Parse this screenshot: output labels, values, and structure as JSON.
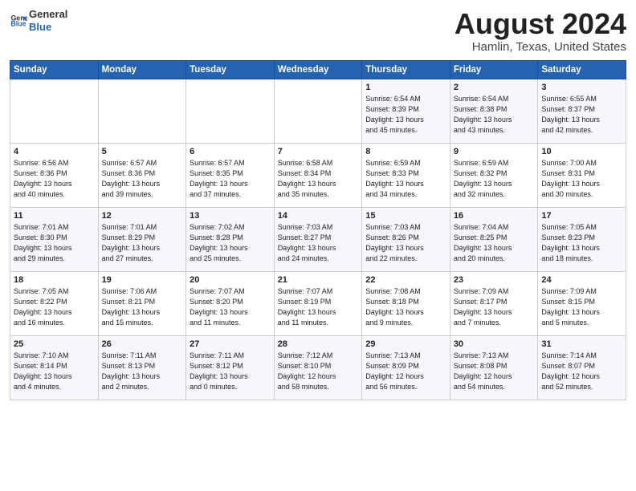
{
  "logo": {
    "general": "General",
    "blue": "Blue"
  },
  "title": "August 2024",
  "location": "Hamlin, Texas, United States",
  "days_header": [
    "Sunday",
    "Monday",
    "Tuesday",
    "Wednesday",
    "Thursday",
    "Friday",
    "Saturday"
  ],
  "weeks": [
    [
      {
        "day": "",
        "info": ""
      },
      {
        "day": "",
        "info": ""
      },
      {
        "day": "",
        "info": ""
      },
      {
        "day": "",
        "info": ""
      },
      {
        "day": "1",
        "info": "Sunrise: 6:54 AM\nSunset: 8:39 PM\nDaylight: 13 hours\nand 45 minutes."
      },
      {
        "day": "2",
        "info": "Sunrise: 6:54 AM\nSunset: 8:38 PM\nDaylight: 13 hours\nand 43 minutes."
      },
      {
        "day": "3",
        "info": "Sunrise: 6:55 AM\nSunset: 8:37 PM\nDaylight: 13 hours\nand 42 minutes."
      }
    ],
    [
      {
        "day": "4",
        "info": "Sunrise: 6:56 AM\nSunset: 8:36 PM\nDaylight: 13 hours\nand 40 minutes."
      },
      {
        "day": "5",
        "info": "Sunrise: 6:57 AM\nSunset: 8:36 PM\nDaylight: 13 hours\nand 39 minutes."
      },
      {
        "day": "6",
        "info": "Sunrise: 6:57 AM\nSunset: 8:35 PM\nDaylight: 13 hours\nand 37 minutes."
      },
      {
        "day": "7",
        "info": "Sunrise: 6:58 AM\nSunset: 8:34 PM\nDaylight: 13 hours\nand 35 minutes."
      },
      {
        "day": "8",
        "info": "Sunrise: 6:59 AM\nSunset: 8:33 PM\nDaylight: 13 hours\nand 34 minutes."
      },
      {
        "day": "9",
        "info": "Sunrise: 6:59 AM\nSunset: 8:32 PM\nDaylight: 13 hours\nand 32 minutes."
      },
      {
        "day": "10",
        "info": "Sunrise: 7:00 AM\nSunset: 8:31 PM\nDaylight: 13 hours\nand 30 minutes."
      }
    ],
    [
      {
        "day": "11",
        "info": "Sunrise: 7:01 AM\nSunset: 8:30 PM\nDaylight: 13 hours\nand 29 minutes."
      },
      {
        "day": "12",
        "info": "Sunrise: 7:01 AM\nSunset: 8:29 PM\nDaylight: 13 hours\nand 27 minutes."
      },
      {
        "day": "13",
        "info": "Sunrise: 7:02 AM\nSunset: 8:28 PM\nDaylight: 13 hours\nand 25 minutes."
      },
      {
        "day": "14",
        "info": "Sunrise: 7:03 AM\nSunset: 8:27 PM\nDaylight: 13 hours\nand 24 minutes."
      },
      {
        "day": "15",
        "info": "Sunrise: 7:03 AM\nSunset: 8:26 PM\nDaylight: 13 hours\nand 22 minutes."
      },
      {
        "day": "16",
        "info": "Sunrise: 7:04 AM\nSunset: 8:25 PM\nDaylight: 13 hours\nand 20 minutes."
      },
      {
        "day": "17",
        "info": "Sunrise: 7:05 AM\nSunset: 8:23 PM\nDaylight: 13 hours\nand 18 minutes."
      }
    ],
    [
      {
        "day": "18",
        "info": "Sunrise: 7:05 AM\nSunset: 8:22 PM\nDaylight: 13 hours\nand 16 minutes."
      },
      {
        "day": "19",
        "info": "Sunrise: 7:06 AM\nSunset: 8:21 PM\nDaylight: 13 hours\nand 15 minutes."
      },
      {
        "day": "20",
        "info": "Sunrise: 7:07 AM\nSunset: 8:20 PM\nDaylight: 13 hours\nand 11 minutes."
      },
      {
        "day": "21",
        "info": "Sunrise: 7:07 AM\nSunset: 8:19 PM\nDaylight: 13 hours\nand 11 minutes."
      },
      {
        "day": "22",
        "info": "Sunrise: 7:08 AM\nSunset: 8:18 PM\nDaylight: 13 hours\nand 9 minutes."
      },
      {
        "day": "23",
        "info": "Sunrise: 7:09 AM\nSunset: 8:17 PM\nDaylight: 13 hours\nand 7 minutes."
      },
      {
        "day": "24",
        "info": "Sunrise: 7:09 AM\nSunset: 8:15 PM\nDaylight: 13 hours\nand 5 minutes."
      }
    ],
    [
      {
        "day": "25",
        "info": "Sunrise: 7:10 AM\nSunset: 8:14 PM\nDaylight: 13 hours\nand 4 minutes."
      },
      {
        "day": "26",
        "info": "Sunrise: 7:11 AM\nSunset: 8:13 PM\nDaylight: 13 hours\nand 2 minutes."
      },
      {
        "day": "27",
        "info": "Sunrise: 7:11 AM\nSunset: 8:12 PM\nDaylight: 13 hours\nand 0 minutes."
      },
      {
        "day": "28",
        "info": "Sunrise: 7:12 AM\nSunset: 8:10 PM\nDaylight: 12 hours\nand 58 minutes."
      },
      {
        "day": "29",
        "info": "Sunrise: 7:13 AM\nSunset: 8:09 PM\nDaylight: 12 hours\nand 56 minutes."
      },
      {
        "day": "30",
        "info": "Sunrise: 7:13 AM\nSunset: 8:08 PM\nDaylight: 12 hours\nand 54 minutes."
      },
      {
        "day": "31",
        "info": "Sunrise: 7:14 AM\nSunset: 8:07 PM\nDaylight: 12 hours\nand 52 minutes."
      }
    ]
  ]
}
